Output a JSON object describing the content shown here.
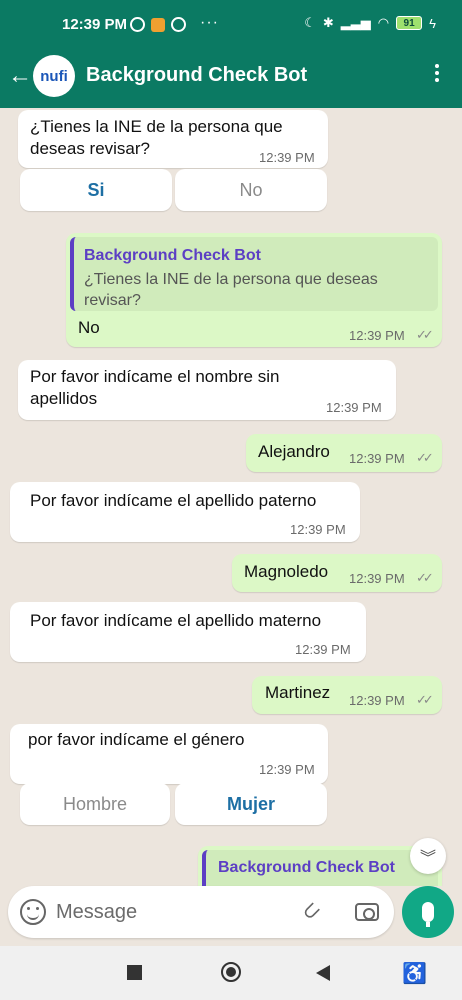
{
  "status_bar": {
    "time": "12:39 PM",
    "battery": "91",
    "more": "···"
  },
  "app_bar": {
    "avatar_text": "nufi",
    "title": "Background Check Bot"
  },
  "messages": [
    {
      "type": "in",
      "text": "¿Tienes la INE de la persona que deseas revisar?",
      "time": "12:39 PM"
    },
    {
      "type": "buttons",
      "options": [
        "Si",
        "No"
      ]
    },
    {
      "type": "out",
      "quote_name": "Background Check Bot",
      "quote_text": "¿Tienes la INE de la persona que deseas revisar?",
      "text": "No",
      "time": "12:39 PM"
    },
    {
      "type": "in",
      "text": "Por favor indícame el nombre sin apellidos",
      "time": "12:39 PM"
    },
    {
      "type": "out",
      "text": "Alejandro",
      "time": "12:39 PM"
    },
    {
      "type": "in",
      "text": "Por favor indícame el apellido paterno",
      "time": "12:39 PM"
    },
    {
      "type": "out",
      "text": "Magnoledo",
      "time": "12:39 PM"
    },
    {
      "type": "in",
      "text": "Por favor indícame el apellido materno",
      "time": "12:39 PM"
    },
    {
      "type": "out",
      "text": "Martinez",
      "time": "12:39 PM"
    },
    {
      "type": "in",
      "text": "por favor indícame el género",
      "time": "12:39 PM"
    },
    {
      "type": "buttons",
      "options": [
        "Hombre",
        "Mujer"
      ]
    },
    {
      "type": "out",
      "quote_name": "Background Check Bot"
    }
  ],
  "input": {
    "placeholder": "Message"
  },
  "colors": {
    "header": "#0b7a63",
    "chat_bg": "#ece5dd",
    "outgoing": "#dcf8c6",
    "accent_button": "#1d6fa4",
    "quote_name": "#5c3fc4",
    "mic": "#11a886"
  }
}
